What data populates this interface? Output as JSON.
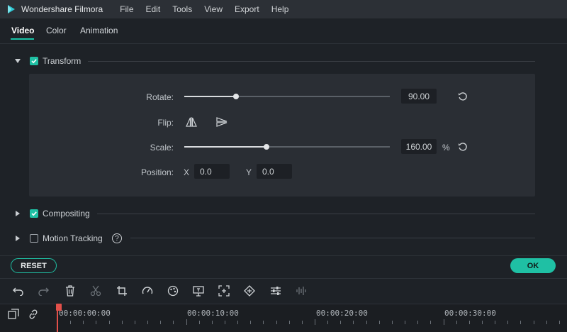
{
  "app": {
    "title": "Wondershare Filmora"
  },
  "menu": [
    "File",
    "Edit",
    "Tools",
    "View",
    "Export",
    "Help"
  ],
  "tabs": [
    "Video",
    "Color",
    "Animation"
  ],
  "active_tab": "Video",
  "colors": {
    "accent": "#1fc0a4",
    "playhead": "#e2504a",
    "panel": "#2a2e34",
    "background": "#1e2227"
  },
  "sections": {
    "transform": {
      "label": "Transform",
      "checked": true,
      "expanded": true
    },
    "compositing": {
      "label": "Compositing",
      "checked": true,
      "expanded": false
    },
    "motion_tracking": {
      "label": "Motion Tracking",
      "checked": false,
      "expanded": false,
      "help": "?"
    }
  },
  "transform": {
    "rotate": {
      "label": "Rotate:",
      "value": "90.00",
      "slider_fraction": 0.25
    },
    "flip": {
      "label": "Flip:",
      "icons": [
        "flip-horizontal-icon",
        "flip-vertical-icon"
      ]
    },
    "scale": {
      "label": "Scale:",
      "value": "160.00",
      "unit": "%",
      "slider_fraction": 0.4
    },
    "position": {
      "label": "Position:",
      "x_label": "X",
      "x_value": "0.0",
      "y_label": "Y",
      "y_value": "0.0"
    }
  },
  "buttons": {
    "reset": "RESET",
    "ok": "OK"
  },
  "toolbar_icons": [
    "undo-icon",
    "redo-icon",
    "delete-icon",
    "cut-icon",
    "crop-icon",
    "speed-icon",
    "color-icon",
    "freeze-frame-icon",
    "zoom-icon",
    "keyframe-icon",
    "adjust-icon",
    "audio-icon"
  ],
  "timeline": {
    "timecodes": [
      "00:00:00:00",
      "00:00:10:00",
      "00:00:20:00",
      "00:00:30:00"
    ]
  }
}
